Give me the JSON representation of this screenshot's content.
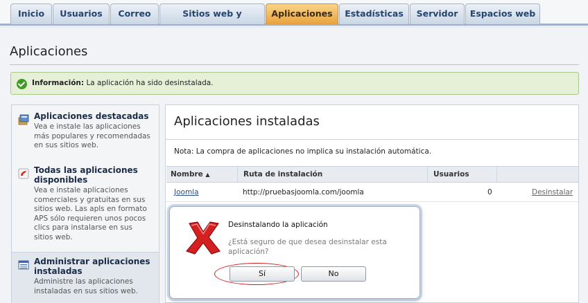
{
  "tabs": [
    {
      "label": "Inicio",
      "active": false
    },
    {
      "label": "Usuarios",
      "active": false
    },
    {
      "label": "Correo",
      "active": false
    },
    {
      "label": "Sitios web y dominios",
      "active": false
    },
    {
      "label": "Aplicaciones",
      "active": true
    },
    {
      "label": "Estadísticas",
      "active": false
    },
    {
      "label": "Servidor",
      "active": false
    },
    {
      "label": "Espacios web",
      "active": false
    }
  ],
  "page": {
    "title": "Aplicaciones"
  },
  "info": {
    "label": "Información:",
    "text": "La aplicación ha sido desinstalada."
  },
  "sidebar": {
    "items": [
      {
        "title": "Aplicaciones destacadas",
        "desc": "Vea e instale las aplicaciones más populares y recomendadas en sus sitios web.",
        "icon": "featured-apps-icon"
      },
      {
        "title": "Todas las aplicaciones disponibles",
        "desc": "Vea e instale aplicaciones comerciales y gratuitas en sus sitios web. Las apls en formato APS sólo requieren unos pocos clics para instalarse en sus sitios web.",
        "icon": "all-apps-icon"
      },
      {
        "title": "Administrar aplicaciones instaladas",
        "desc": "Administre las aplicaciones instaladas en sus sitios web.",
        "icon": "manage-apps-icon"
      }
    ]
  },
  "main": {
    "title": "Aplicaciones instaladas",
    "note": "Nota: La compra de aplicaciones no implica su instalación automática.",
    "columns": {
      "name": "Nombre",
      "sort_indicator": "▲",
      "path": "Ruta de instalación",
      "users": "Usuarios"
    },
    "rows": [
      {
        "name": "Joomla",
        "path": "http://pruebasjoomla.com/joomla",
        "users": "0",
        "action": "Desinstalar"
      }
    ]
  },
  "dialog": {
    "title": "Desinstalando la aplicación",
    "message": "¿Está seguro de que desea desinstalar esta aplicación?",
    "yes_label": "Sí",
    "no_label": "No"
  },
  "colors": {
    "active_tab": "#e8a23e",
    "highlight_circle": "#d21d1d",
    "error_icon": "#d42020"
  }
}
